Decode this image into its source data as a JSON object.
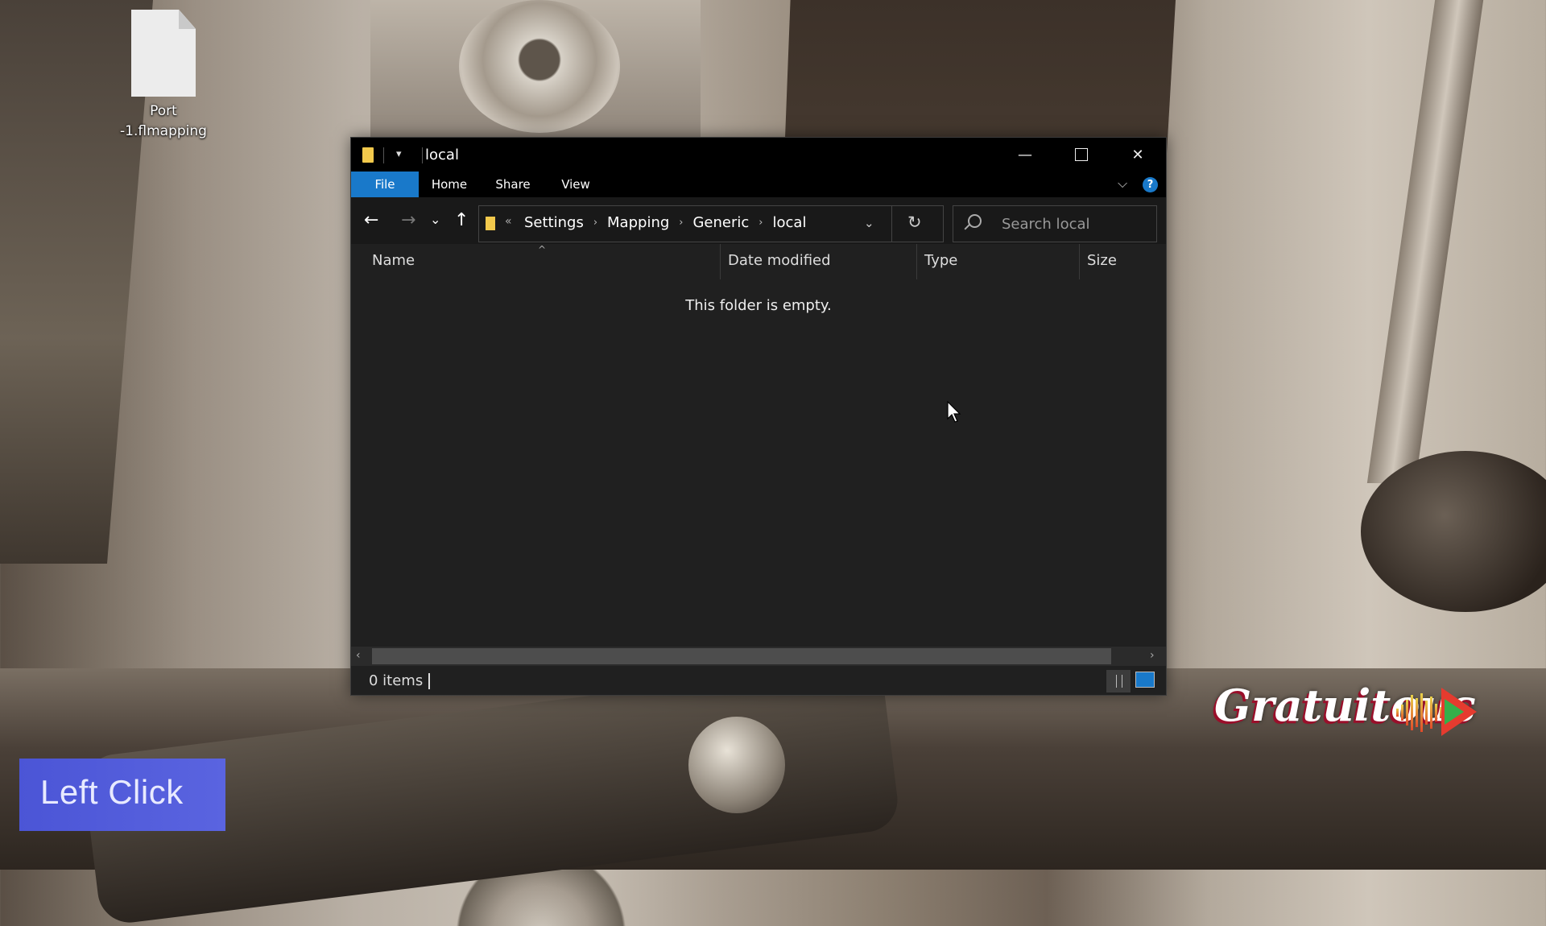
{
  "desktop": {
    "icon_label_line1": "Port",
    "icon_label_line2": "-1.flmapping"
  },
  "window": {
    "title": "local",
    "controls": {
      "minimize": "—",
      "maximize": "",
      "close": "✕"
    },
    "ribbon": {
      "tabs": [
        "File",
        "Home",
        "Share",
        "View"
      ],
      "active_tab": "File",
      "help": "?"
    },
    "nav": {
      "back": "←",
      "forward": "→",
      "recent": "⌄",
      "up": "↑"
    },
    "address": {
      "overflow": "«",
      "crumbs": [
        "Settings",
        "Mapping",
        "Generic",
        "local"
      ],
      "separator": "›"
    },
    "search": {
      "placeholder": "Search local"
    },
    "columns": [
      "Name",
      "Date modified",
      "Type",
      "Size"
    ],
    "sort_indicator": "^",
    "empty_message": "This folder is empty.",
    "status": {
      "items": "0 items"
    }
  },
  "overlay": {
    "left_click_label": "Left Click",
    "logo_text": "Gratuitous"
  },
  "colors": {
    "accent": "#1979ca",
    "window_bg": "#202020",
    "titlebar_bg": "#000000",
    "badge_bg": "#4b55d6"
  }
}
